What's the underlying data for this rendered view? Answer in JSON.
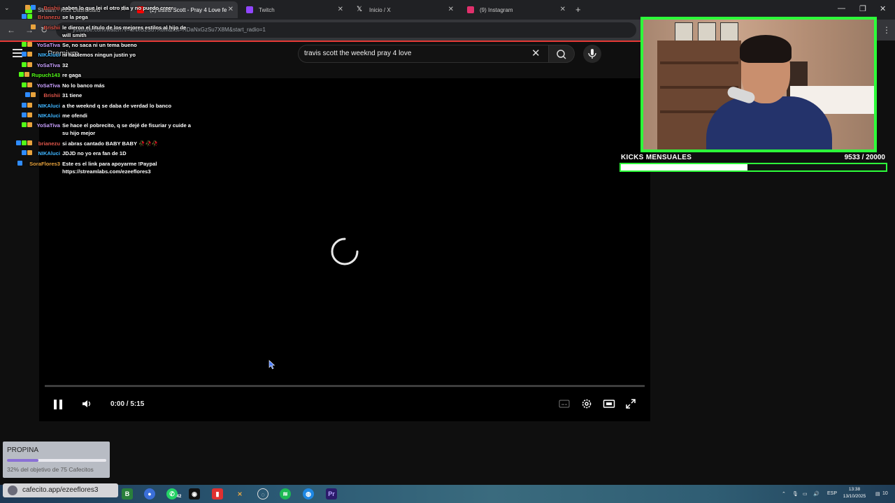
{
  "browser": {
    "tabs": [
      {
        "title": "Stream - Kick Dashboard",
        "favicon_color": "#53fc18"
      },
      {
        "title": "(2) travis Scott - Pray 4 Love fe",
        "favicon_color": "#ff0000"
      },
      {
        "title": "Twitch",
        "favicon_color": "#9146ff"
      },
      {
        "title": "Inicio / X",
        "favicon_color": "#ffffff"
      },
      {
        "title": "(9) Instagram",
        "favicon_color": "#e1306c"
      }
    ],
    "address": "youtube.com/watch?v=aNxGzSu7X8M&list=RDaNxGzSu7X8M&start_radio=1"
  },
  "youtube": {
    "logo_text": "Premium",
    "search_value": "travis scott the weeknd pray 4 love"
  },
  "player": {
    "time_display": "0:00 / 5:15",
    "progress": 0
  },
  "chat": [
    {
      "user": "Brishii",
      "color": "#e0564a",
      "text": "saben lo que lei el otro dia y no puedo creer",
      "badges": [
        "#e8a33d",
        "#2f8cff"
      ]
    },
    {
      "user": "Brianezu",
      "color": "#e0564a",
      "text": "se la pega",
      "badges": [
        "#2f8cff",
        "#53fc18"
      ]
    },
    {
      "user": "Brishii",
      "color": "#e0564a",
      "text": "le dieron el titulo de los mejores estilos al hijo de will smith",
      "badges": [
        "#e8a33d"
      ]
    },
    {
      "user": "YoSaTiva",
      "color": "#c9a0ff",
      "text": "Se, no saca ni un tema bueno",
      "badges": [
        "#53fc18",
        "#e8a33d"
      ]
    },
    {
      "user": "NIKAluci",
      "color": "#3fb5ff",
      "text": "ni hablemos ningun justin yo",
      "badges": [
        "#2f8cff",
        "#e8a33d"
      ]
    },
    {
      "user": "YoSaTiva",
      "color": "#c9a0ff",
      "text": "32",
      "badges": [
        "#53fc18",
        "#e8a33d"
      ]
    },
    {
      "user": "Rupuch143",
      "color": "#53fc18",
      "text": "re gaga",
      "badges": [
        "#53fc18",
        "#e8a33d"
      ]
    },
    {
      "user": "YoSaTiva",
      "color": "#c9a0ff",
      "text": "No lo banco más",
      "badges": [
        "#53fc18",
        "#e8a33d"
      ]
    },
    {
      "user": "Brishii",
      "color": "#e0564a",
      "text": "31 tiene",
      "badges": [
        "#2f8cff",
        "#e8a33d"
      ]
    },
    {
      "user": "NIKAluci",
      "color": "#3fb5ff",
      "text": "a the weeknd q se daba de verdad lo banco",
      "badges": [
        "#2f8cff",
        "#e8a33d"
      ]
    },
    {
      "user": "NIKAluci",
      "color": "#3fb5ff",
      "text": "me ofendi",
      "badges": [
        "#2f8cff",
        "#e8a33d"
      ]
    },
    {
      "user": "YoSaTiva",
      "color": "#c9a0ff",
      "text": "Se hace el pobrecito, q se dejé de fisuriar y cuide a su hijo mejor",
      "badges": [
        "#53fc18",
        "#e8a33d"
      ]
    },
    {
      "user": "brianezu",
      "color": "#e0564a",
      "text": "si abras cantado BABY BABY 🥀🥀🥀",
      "badges": [
        "#2f8cff",
        "#53fc18",
        "#e8a33d"
      ]
    },
    {
      "user": "NIKAluci",
      "color": "#3fb5ff",
      "text": "JDJD no yo era fan de 1D",
      "badges": [
        "#2f8cff",
        "#e8a33d"
      ]
    },
    {
      "user": "SoraFlores3",
      "color": "#e8a33d",
      "text": "Este es el link para apoyarme !Paypal https://streamlabs.com/ezeeflores3",
      "badges": [
        "#2f8cff"
      ]
    }
  ],
  "kicks": {
    "title": "KICKS MENSUALES",
    "count": "9533  / 20000",
    "fraction": 0.4767
  },
  "propina": {
    "title": "PROPINA",
    "subtitle": "32% del objetivo de 75 Cafecitos",
    "fraction": 0.32
  },
  "cafecito": {
    "label": "cafecito.app/ezeeflores3"
  },
  "taskbar": {
    "badge_count": "42",
    "language": "ESP",
    "time": "13:38",
    "date": "13/10/2025",
    "notifications": "10"
  }
}
